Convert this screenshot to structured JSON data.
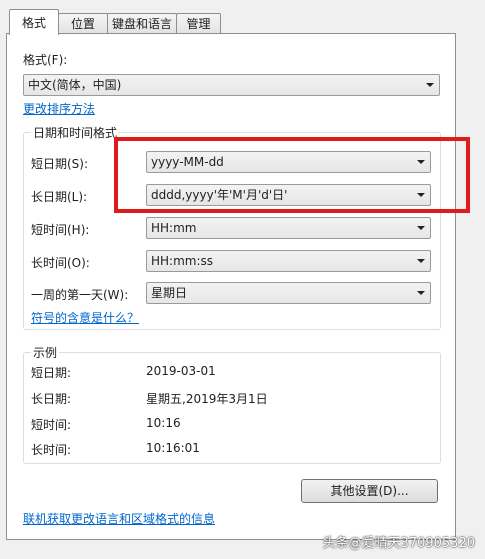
{
  "tabs": [
    {
      "label": "格式"
    },
    {
      "label": "位置"
    },
    {
      "label": "键盘和语言"
    },
    {
      "label": "管理"
    }
  ],
  "format": {
    "label": "格式(F):",
    "value": "中文(简体，中国)",
    "change_sort_link": "更改排序方法"
  },
  "datetime": {
    "group_title": "日期和时间格式",
    "short_date": {
      "label": "短日期(S):",
      "value": "yyyy-MM-dd"
    },
    "long_date": {
      "label": "长日期(L):",
      "value": "dddd,yyyy'年'M'月'd'日'"
    },
    "short_time": {
      "label": "短时间(H):",
      "value": "HH:mm"
    },
    "long_time": {
      "label": "长时间(O):",
      "value": "HH:mm:ss"
    },
    "first_day": {
      "label": "一周的第一天(W):",
      "value": "星期日"
    },
    "symbols_link": "符号的含意是什么？"
  },
  "examples": {
    "group_title": "示例",
    "short_date": {
      "label": "短日期:",
      "value": "2019-03-01"
    },
    "long_date": {
      "label": "长日期:",
      "value": "星期五,2019年3月1日"
    },
    "short_time": {
      "label": "短时间:",
      "value": "10:16"
    },
    "long_time": {
      "label": "长时间:",
      "value": "10:16:01"
    }
  },
  "other_settings_button": "其他设置(D)...",
  "online_info_link": "联机获取更改语言和区域格式的信息",
  "watermark": "头条@爱晴天370905320",
  "colors": {
    "highlight_box": "#e01b1b",
    "link": "#0066cc",
    "panel_bg": "#ffffff",
    "window_bg": "#f0f0f0"
  }
}
